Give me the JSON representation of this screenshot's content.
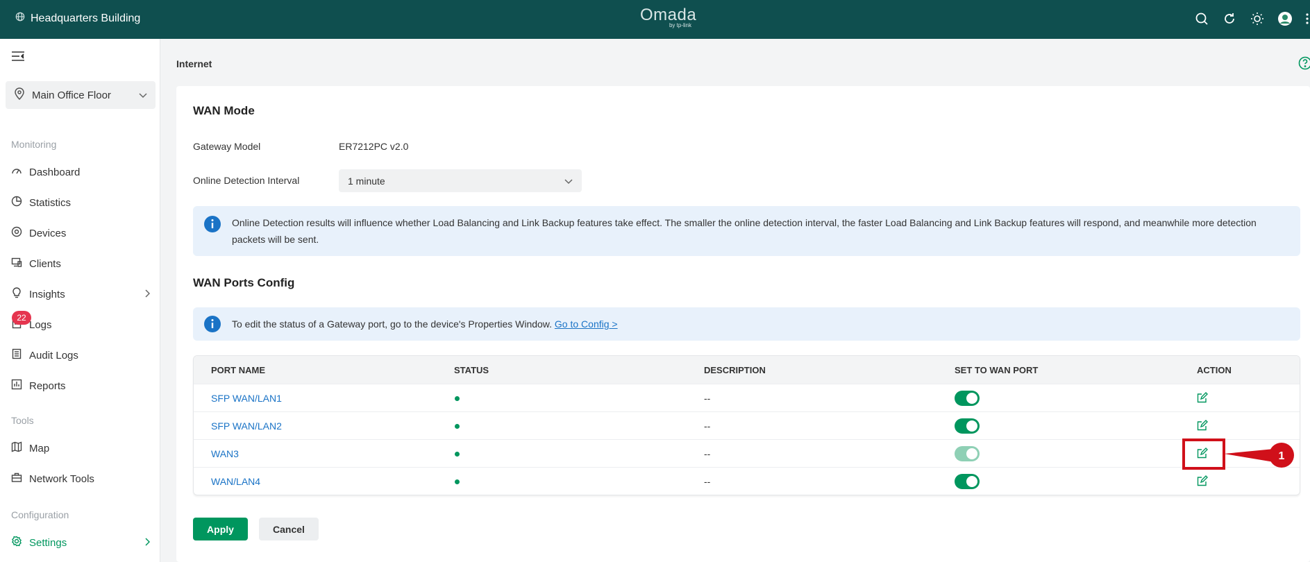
{
  "header": {
    "site_name": "Headquarters Building",
    "logo_main": "Omada",
    "logo_sub": "by tp-link",
    "icons": [
      "search-icon",
      "refresh-icon",
      "theme-icon",
      "avatar",
      "more-icon"
    ]
  },
  "sidebar": {
    "site_selector": "Main Office Floor",
    "sections": {
      "monitoring": "Monitoring",
      "tools": "Tools",
      "configuration": "Configuration"
    },
    "items": [
      {
        "label": "Dashboard",
        "icon": "dashboard-icon"
      },
      {
        "label": "Statistics",
        "icon": "pie-chart-icon"
      },
      {
        "label": "Devices",
        "icon": "devices-icon"
      },
      {
        "label": "Clients",
        "icon": "clients-icon"
      },
      {
        "label": "Insights",
        "icon": "lightbulb-icon"
      },
      {
        "label": "Logs",
        "icon": "logs-icon",
        "badge": "22"
      },
      {
        "label": "Audit Logs",
        "icon": "audit-logs-icon"
      },
      {
        "label": "Reports",
        "icon": "reports-icon"
      },
      {
        "label": "Map",
        "icon": "map-icon"
      },
      {
        "label": "Network Tools",
        "icon": "toolbox-icon"
      },
      {
        "label": "Settings",
        "icon": "settings-icon"
      }
    ]
  },
  "page": {
    "title": "Internet",
    "wan_mode": {
      "heading": "WAN Mode",
      "gateway_model_label": "Gateway Model",
      "gateway_model_value": "ER7212PC v2.0",
      "detection_label": "Online Detection Interval",
      "detection_value": "1 minute",
      "info_text": "Online Detection results will influence whether Load Balancing and Link Backup features take effect. The smaller the online detection interval, the faster Load Balancing and Link Backup features will respond, and meanwhile more detection packets will be sent."
    },
    "wan_ports": {
      "heading": "WAN Ports Config",
      "info_text": "To edit the status of a Gateway port, go to the device's Properties Window.",
      "info_link": "Go to Config >",
      "columns": [
        "PORT NAME",
        "STATUS",
        "DESCRIPTION",
        "SET TO WAN PORT",
        "ACTION"
      ],
      "rows": [
        {
          "name": "SFP WAN/LAN1",
          "status": "online",
          "description": "--",
          "wan_enabled": true,
          "toggle_disabled": false
        },
        {
          "name": "SFP WAN/LAN2",
          "status": "online",
          "description": "--",
          "wan_enabled": true,
          "toggle_disabled": false
        },
        {
          "name": "WAN3",
          "status": "online",
          "description": "--",
          "wan_enabled": true,
          "toggle_disabled": true
        },
        {
          "name": "WAN/LAN4",
          "status": "online",
          "description": "--",
          "wan_enabled": true,
          "toggle_disabled": false
        }
      ]
    },
    "buttons": {
      "apply": "Apply",
      "cancel": "Cancel"
    }
  },
  "annotation": {
    "callout_number": "1",
    "color": "#d0101a"
  },
  "colors": {
    "header_bg": "#0f4f4f",
    "accent": "#00965e",
    "link": "#1a73c6",
    "badge": "#e5354f"
  }
}
